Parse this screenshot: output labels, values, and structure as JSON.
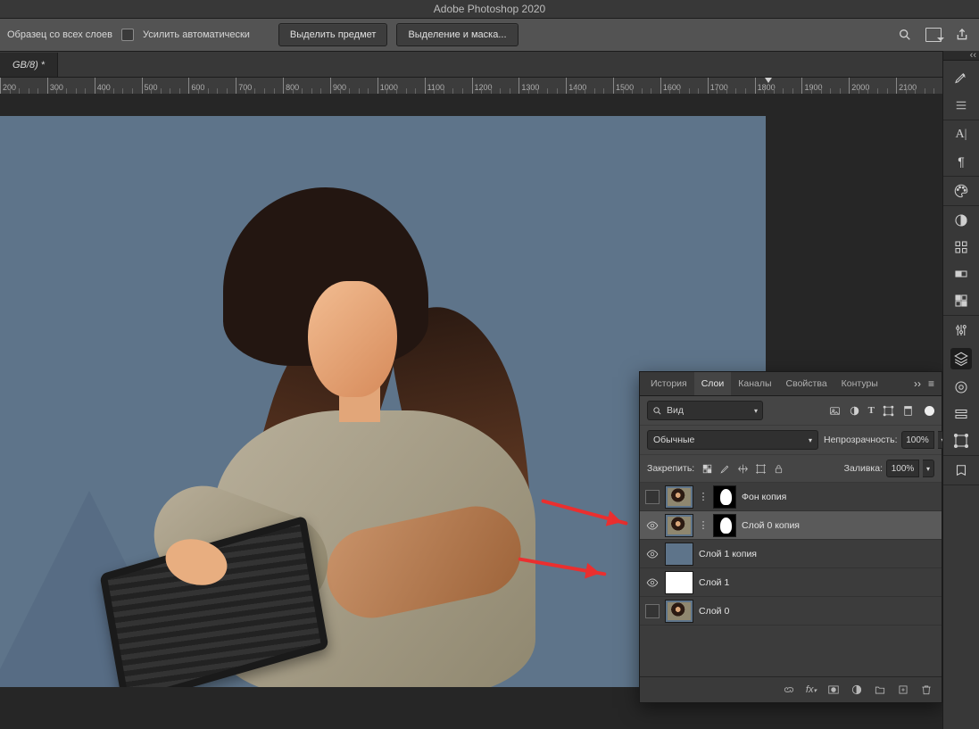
{
  "app_title": "Adobe Photoshop 2020",
  "options_bar": {
    "sample_label": "Образец со всех слоев",
    "enhance_label": "Усилить автоматически",
    "select_subject_btn": "Выделить предмет",
    "select_mask_btn": "Выделение и маска..."
  },
  "document_tab": "GB/8) *",
  "ruler": {
    "start": 200,
    "end": 2200,
    "step": 100,
    "caret_at": 1830
  },
  "panel": {
    "tabs": [
      "История",
      "Слои",
      "Каналы",
      "Свойства",
      "Контуры"
    ],
    "active_tab": "Слои",
    "filter_label": "Вид",
    "blend_mode": "Обычные",
    "opacity_label": "Непрозрачность:",
    "opacity_value": "100%",
    "lock_label": "Закрепить:",
    "fill_label": "Заливка:",
    "fill_value": "100%",
    "layers": [
      {
        "name": "Фон копия",
        "visible": false,
        "thumb": "photo",
        "mask": true,
        "selected": false
      },
      {
        "name": "Слой 0 копия",
        "visible": true,
        "thumb": "photo",
        "mask": true,
        "selected": true
      },
      {
        "name": "Слой 1 копия",
        "visible": true,
        "thumb": "blue",
        "mask": false,
        "selected": false
      },
      {
        "name": "Слой 1",
        "visible": true,
        "thumb": "white",
        "mask": false,
        "selected": false
      },
      {
        "name": "Слой 0",
        "visible": false,
        "thumb": "photo",
        "mask": false,
        "selected": false
      }
    ]
  }
}
